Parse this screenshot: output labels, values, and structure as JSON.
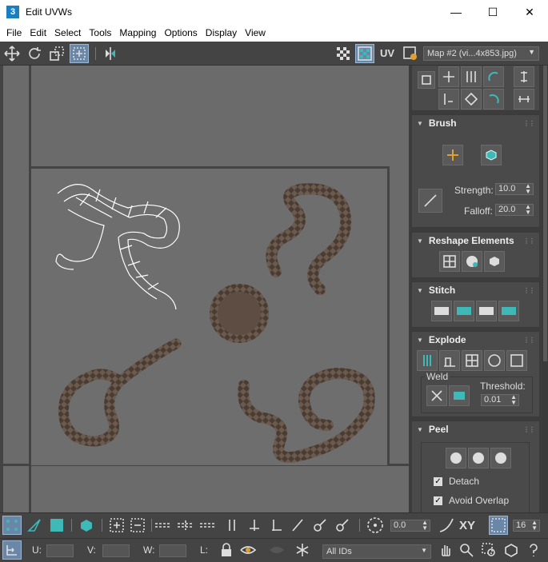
{
  "window": {
    "app_icon": "3",
    "title": "Edit UVWs",
    "controls": [
      "minimize",
      "maximize",
      "close"
    ]
  },
  "menu": [
    "File",
    "Edit",
    "Select",
    "Tools",
    "Mapping",
    "Options",
    "Display",
    "View"
  ],
  "toolbar_top": {
    "uv_label": "UV",
    "map_select": "Map #2 (vi...4x853.jpg)"
  },
  "panel": {
    "brush": {
      "title": "Brush",
      "strength_label": "Strength:",
      "strength_value": "10.0",
      "falloff_label": "Falloff:",
      "falloff_value": "20.0"
    },
    "reshape": {
      "title": "Reshape Elements"
    },
    "stitch": {
      "title": "Stitch"
    },
    "explode": {
      "title": "Explode",
      "weld_label": "Weld",
      "threshold_label": "Threshold:",
      "threshold_value": "0.01"
    },
    "peel": {
      "title": "Peel",
      "detach_label": "Detach",
      "detach_checked": true,
      "avoid_overlap_label": "Avoid Overlap",
      "avoid_overlap_checked": true
    }
  },
  "bottom1": {
    "value_field": "0.0",
    "xy_label": "XY",
    "grid_value": "16"
  },
  "bottom2": {
    "u_label": "U:",
    "v_label": "V:",
    "w_label": "W:",
    "l_label": "L:",
    "ids_select": "All IDs"
  },
  "colors": {
    "accent": "#3fb8b8",
    "viewport_bg": "#6b6b6b",
    "panel_bg": "#4a4a4a",
    "active_button": "#6b87a8"
  }
}
